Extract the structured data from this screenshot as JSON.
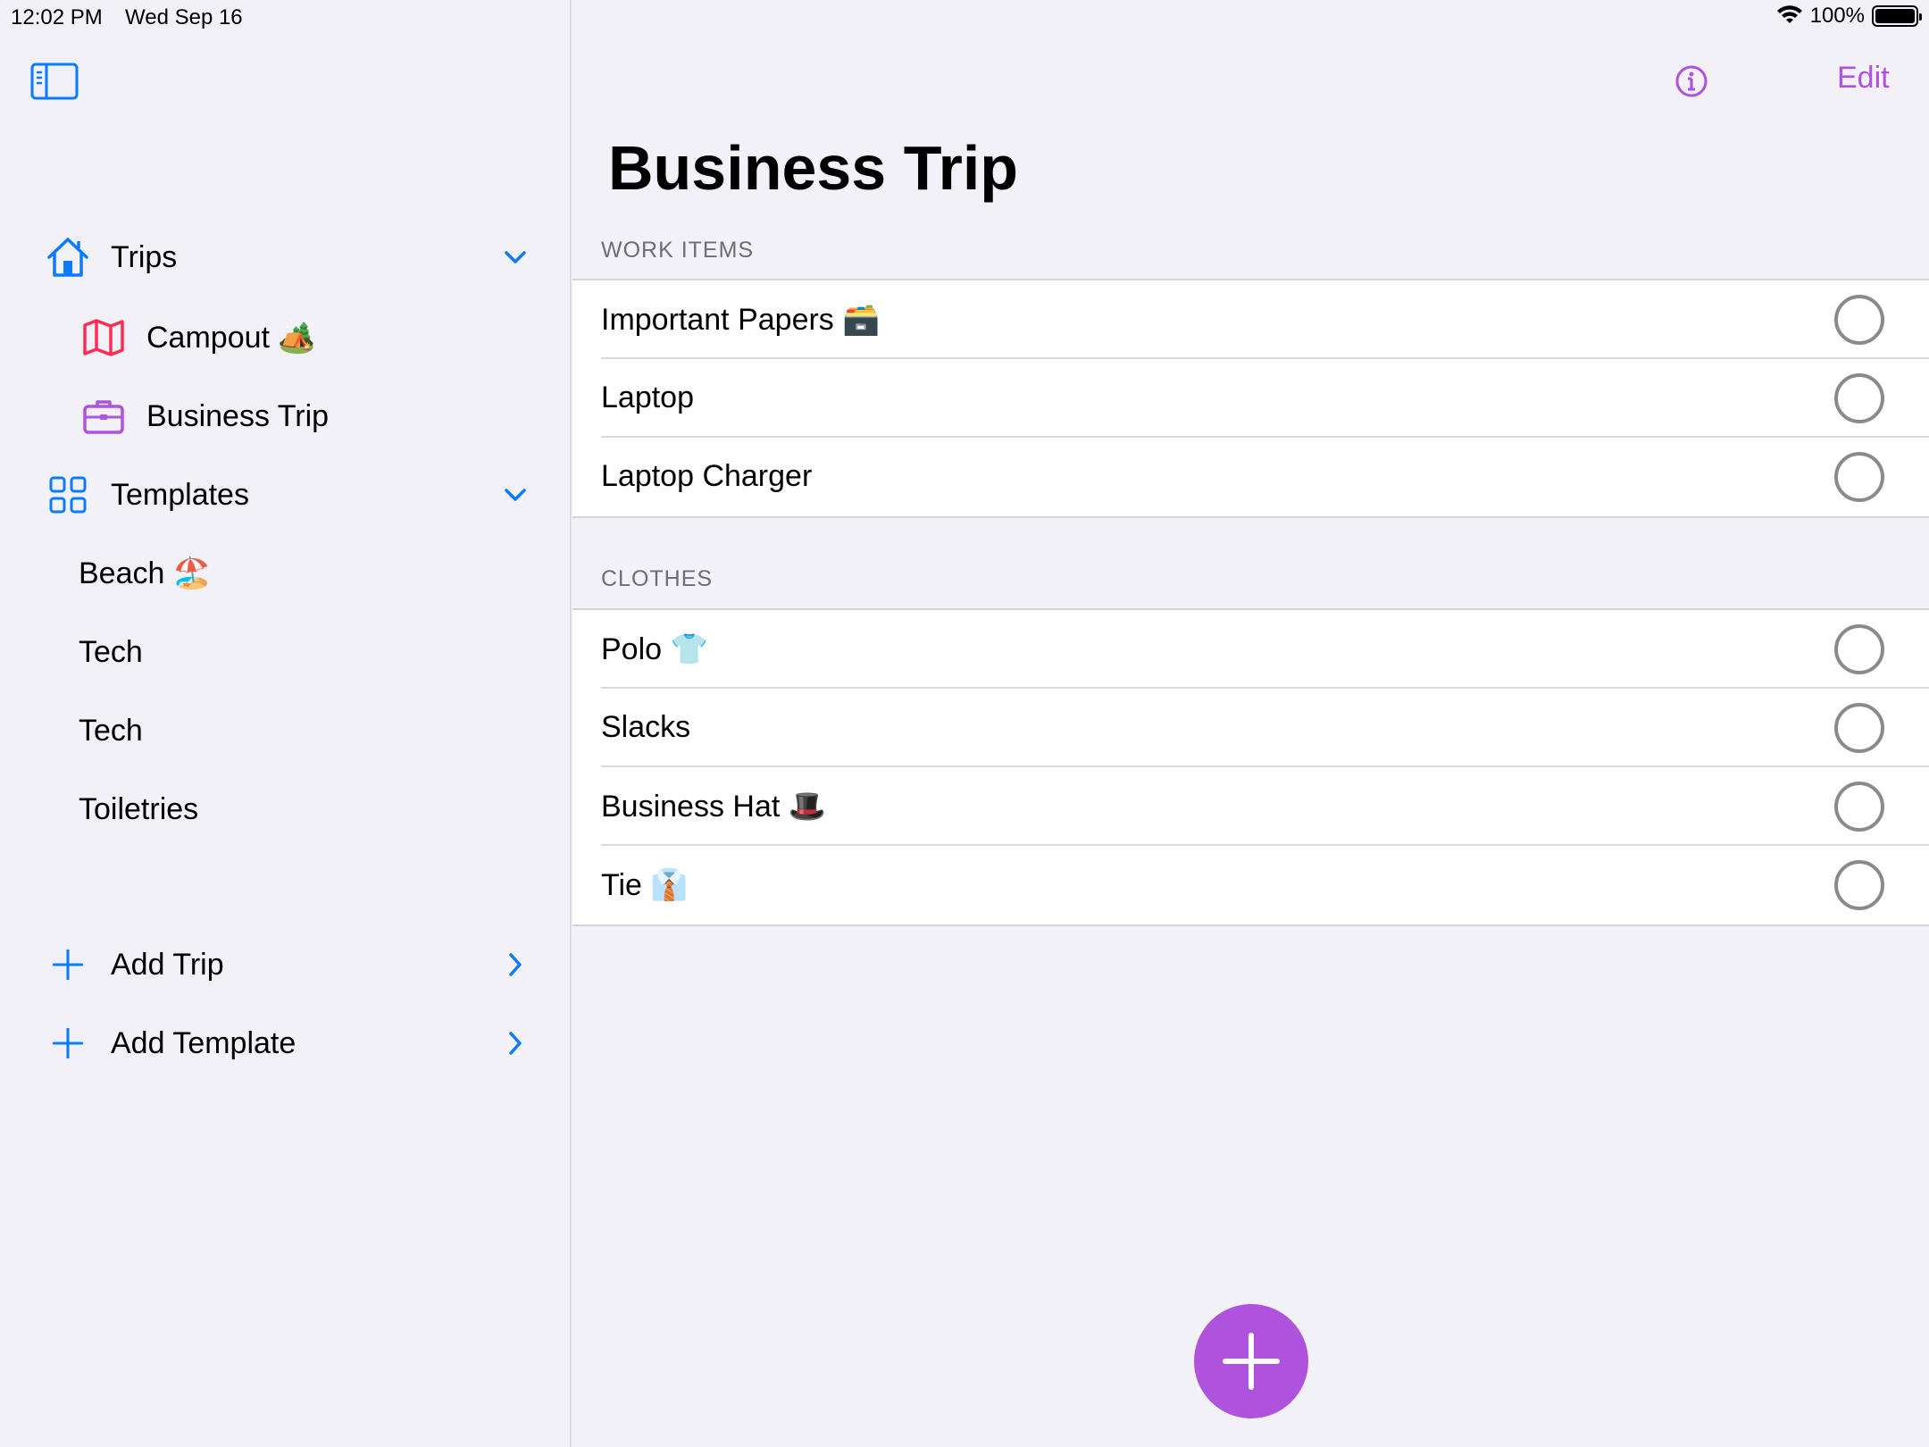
{
  "status": {
    "time": "12:02 PM",
    "date": "Wed Sep 16",
    "battery": "100%"
  },
  "colors": {
    "accent": "#af52de",
    "blue": "#0a7aff",
    "red": "#ff2d55",
    "background": "#f2f1f7"
  },
  "sidebar": {
    "trips": {
      "label": "Trips",
      "items": [
        {
          "label": "Campout 🏕️",
          "icon": "map-icon"
        },
        {
          "label": "Business Trip",
          "icon": "briefcase-icon"
        }
      ]
    },
    "templates": {
      "label": "Templates",
      "items": [
        {
          "label": "Beach 🏖️"
        },
        {
          "label": "Tech"
        },
        {
          "label": "Tech"
        },
        {
          "label": "Toiletries"
        }
      ]
    },
    "actions": [
      {
        "label": "Add Trip"
      },
      {
        "label": "Add Template"
      }
    ]
  },
  "main": {
    "title": "Business Trip",
    "edit_label": "Edit",
    "sections": [
      {
        "header": "WORK ITEMS",
        "items": [
          {
            "label": "Important Papers 🗃️",
            "checked": false
          },
          {
            "label": "Laptop",
            "checked": false
          },
          {
            "label": "Laptop Charger",
            "checked": false
          }
        ]
      },
      {
        "header": "CLOTHES",
        "items": [
          {
            "label": "Polo 👕",
            "checked": false
          },
          {
            "label": "Slacks",
            "checked": false
          },
          {
            "label": "Business Hat 🎩",
            "checked": false
          },
          {
            "label": "Tie 👔",
            "checked": false
          }
        ]
      }
    ]
  }
}
